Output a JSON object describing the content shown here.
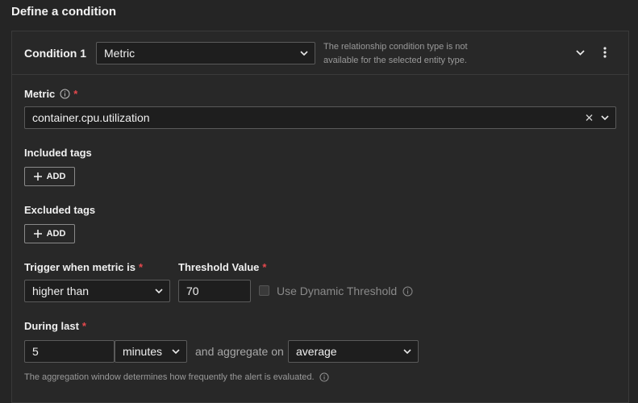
{
  "header": {
    "title": "Define a condition"
  },
  "condition": {
    "label": "Condition 1",
    "type_value": "Metric",
    "notice": "The relationship condition type is not available for the selected entity type."
  },
  "metric": {
    "label": "Metric",
    "required_mark": "*",
    "value": "container.cpu.utilization"
  },
  "included_tags": {
    "label": "Included tags",
    "add_label": "ADD"
  },
  "excluded_tags": {
    "label": "Excluded tags",
    "add_label": "ADD"
  },
  "trigger": {
    "label": "Trigger when metric is",
    "required_mark": "*",
    "value": "higher than"
  },
  "threshold": {
    "label": "Threshold Value",
    "required_mark": "*",
    "value": "70",
    "dynamic_label": "Use Dynamic Threshold"
  },
  "during": {
    "label": "During last",
    "required_mark": "*",
    "value": "5",
    "unit": "minutes",
    "aggregate_text": "and aggregate on",
    "aggregate_value": "average"
  },
  "help_text": "The aggregation window determines how frequently the alert is evaluated.",
  "colors": {
    "required": "#e5484d",
    "background": "#252525",
    "field": "#1e1e1e"
  },
  "icons": [
    "chevron-down-icon",
    "kebab-menu-icon",
    "info-icon",
    "close-icon",
    "plus-icon"
  ]
}
